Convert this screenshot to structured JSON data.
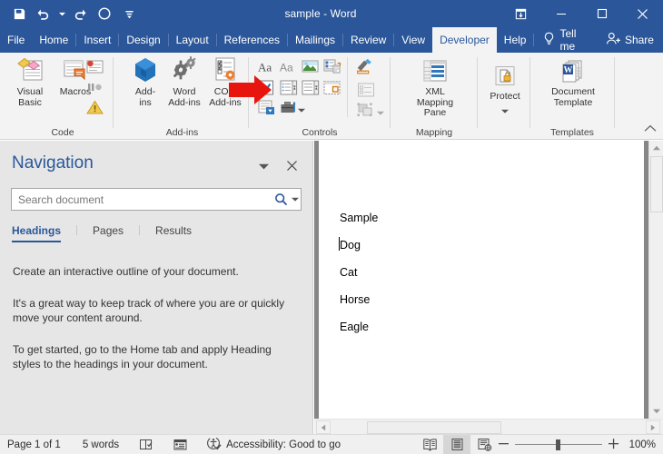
{
  "window": {
    "document_title": "sample  -  Word",
    "quick_access": [
      {
        "name": "save-icon",
        "label": "Save"
      },
      {
        "name": "undo-icon",
        "label": "Undo"
      },
      {
        "name": "undo-dropdown-caret-icon",
        "label": "Undo options"
      },
      {
        "name": "redo-icon",
        "label": "Redo"
      },
      {
        "name": "touch-mode-icon",
        "label": "Touch/Mouse Mode"
      },
      {
        "name": "customize-quick-access-toolbar-icon",
        "label": "Customize Quick Access Toolbar"
      }
    ],
    "ribbon_display_options_label": "Ribbon Display Options",
    "minimize_label": "Minimize",
    "maximize_label": "Restore Down",
    "close_label": "Close"
  },
  "tabs": [
    {
      "label": "File",
      "active": false
    },
    {
      "label": "Home",
      "active": false
    },
    {
      "label": "Insert",
      "active": false
    },
    {
      "label": "Design",
      "active": false
    },
    {
      "label": "Layout",
      "active": false
    },
    {
      "label": "References",
      "active": false
    },
    {
      "label": "Mailings",
      "active": false
    },
    {
      "label": "Review",
      "active": false
    },
    {
      "label": "View",
      "active": false
    },
    {
      "label": "Developer",
      "active": true
    },
    {
      "label": "Help",
      "active": false
    }
  ],
  "tellme": {
    "label": "Tell me",
    "icon": "lightbulb-icon"
  },
  "share": {
    "label": "Share",
    "icon": "share-person-icon"
  },
  "ribbon": {
    "groups": [
      {
        "name": "Code",
        "label": "Code",
        "buttons": [
          {
            "name": "visual-basic-button",
            "label": "Visual\nBasic"
          },
          {
            "name": "macros-button",
            "label": "Macros"
          }
        ],
        "small_buttons": [
          {
            "name": "record-macro-icon",
            "label": "Record Macro"
          },
          {
            "name": "pause-recording-icon",
            "label": "Pause Recording"
          },
          {
            "name": "macro-security-icon",
            "label": "Macro Security"
          }
        ]
      },
      {
        "name": "Add-ins",
        "label": "Add-ins",
        "buttons": [
          {
            "name": "add-ins-button",
            "label": "Add-\nins"
          },
          {
            "name": "word-add-ins-button",
            "label": "Word\nAdd-ins"
          },
          {
            "name": "com-add-ins-button",
            "label": "COM\nAdd-ins"
          }
        ]
      },
      {
        "name": "Controls",
        "label": "Controls",
        "small_buttons": [
          {
            "name": "rich-text-content-control-icon",
            "label": "Rich Text Content Control"
          },
          {
            "name": "plain-text-content-control-icon",
            "label": "Plain Text Content Control"
          },
          {
            "name": "picture-content-control-icon",
            "label": "Picture Content Control"
          },
          {
            "name": "building-block-gallery-content-control-icon",
            "label": "Building Block Gallery Content Control"
          },
          {
            "name": "check-box-content-control-icon",
            "label": "Check Box Content Control"
          },
          {
            "name": "combo-box-content-control-icon",
            "label": "Combo Box Content Control"
          },
          {
            "name": "drop-down-list-content-control-icon",
            "label": "Drop-Down List Content Control"
          },
          {
            "name": "date-picker-content-control-icon",
            "label": "Date Picker Content Control"
          },
          {
            "name": "repeating-section-content-control-icon",
            "label": "Repeating Section Content Control"
          },
          {
            "name": "legacy-tools-icon",
            "label": "Legacy Tools"
          },
          {
            "name": "design-mode-icon",
            "label": "Design Mode"
          },
          {
            "name": "properties-icon",
            "label": "Properties"
          },
          {
            "name": "group-icon",
            "label": "Group"
          }
        ]
      },
      {
        "name": "Mapping",
        "label": "Mapping",
        "buttons": [
          {
            "name": "xml-mapping-pane-button",
            "label": "XML Mapping\nPane"
          }
        ]
      },
      {
        "name": "Protect",
        "label": "",
        "buttons": [
          {
            "name": "protect-button",
            "label": "Protect"
          }
        ]
      },
      {
        "name": "Templates",
        "label": "Templates",
        "buttons": [
          {
            "name": "document-template-button",
            "label": "Document\nTemplate"
          }
        ]
      }
    ],
    "collapse_label": "Collapse the Ribbon"
  },
  "annotation": {
    "name": "red-arrow-pointer",
    "points_to": "check-box-content-control-icon",
    "color": "#e8150f"
  },
  "navigation": {
    "title": "Navigation",
    "caret_label": "Navigation pane options",
    "close_label": "Close",
    "search": {
      "value": "",
      "placeholder": "Search document",
      "icon": "search-icon",
      "caret": "search-options-caret-icon"
    },
    "tabs": [
      {
        "label": "Headings",
        "active": true
      },
      {
        "label": "Pages",
        "active": false
      },
      {
        "label": "Results",
        "active": false
      }
    ],
    "body": [
      "Create an interactive outline of your document.",
      "It's a great way to keep track of where you are or quickly move your content around.",
      "To get started, go to the Home tab and apply Heading styles to the headings in your document."
    ]
  },
  "document": {
    "lines": [
      "Sample",
      "Dog",
      "Cat",
      "Horse",
      "Eagle"
    ],
    "cursor_line_index": 1
  },
  "statusbar": {
    "page": "Page 1 of 1",
    "words": "5 words",
    "proofing_icon": "spelling-and-grammar-check-icon",
    "language_icon": "language-icon",
    "accessibility_icon": "accessibility-checker-icon",
    "accessibility": "Accessibility: Good to go",
    "views": [
      {
        "name": "read-mode-view-button",
        "label": "Read Mode",
        "active": false
      },
      {
        "name": "print-layout-view-button",
        "label": "Print Layout",
        "active": true
      },
      {
        "name": "web-layout-view-button",
        "label": "Web Layout",
        "active": false
      }
    ],
    "zoom_out_label": "Zoom Out",
    "zoom_in_label": "Zoom In",
    "zoom_level": "100%"
  },
  "colors": {
    "word_blue": "#2b579a",
    "ribbon_bg": "#f3f3f3",
    "pane_bg": "#e6e6e6",
    "accent_red": "#e8150f"
  }
}
